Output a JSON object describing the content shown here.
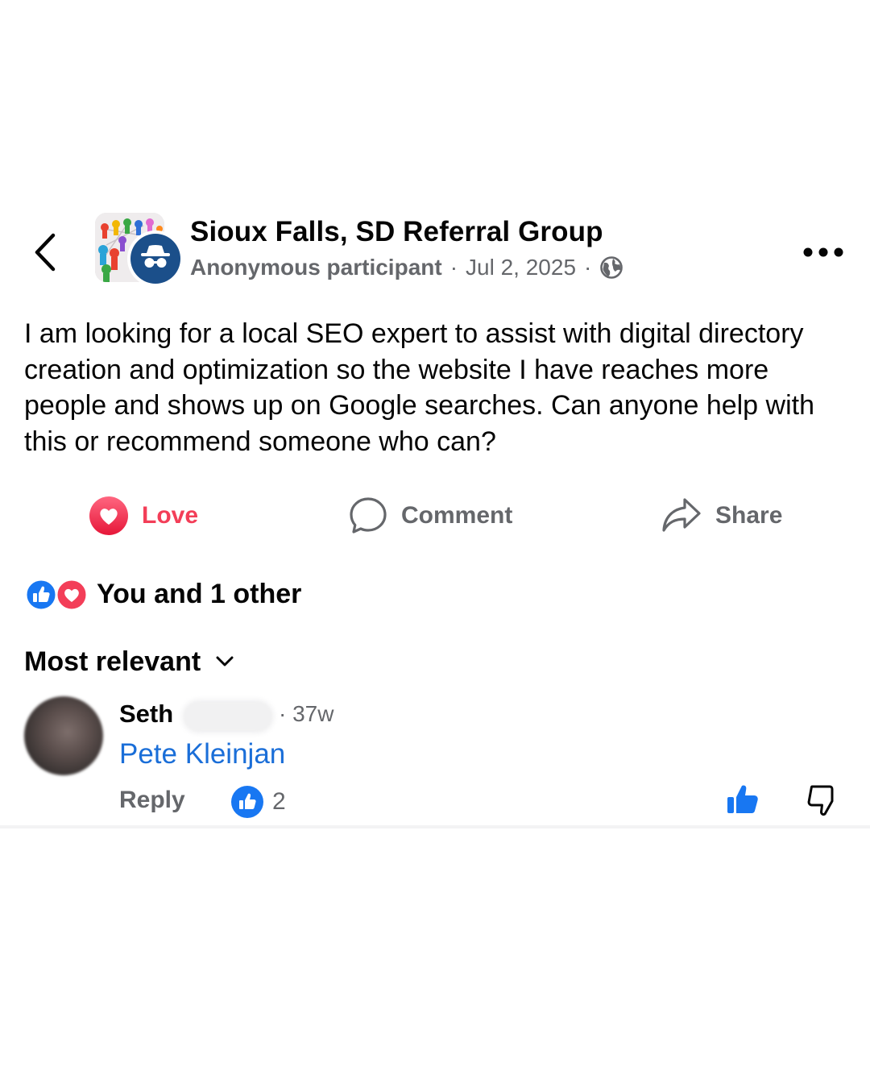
{
  "header": {
    "back_icon": "chevron-left-icon",
    "group_name": "Sioux Falls, SD Referral Group",
    "author": "Anonymous participant",
    "separator": "·",
    "date": "Jul 2, 2025",
    "audience_icon": "globe-icon",
    "more_icon": "more-horizontal-icon"
  },
  "post": {
    "text": "I am looking for a local SEO expert to assist with digital directory creation and optimization so the website I have reaches more people and shows up on Google searches. Can anyone help with this or recommend someone who can?"
  },
  "actions": {
    "love_label": "Love",
    "comment_label": "Comment",
    "share_label": "Share"
  },
  "reactions": {
    "summary": "You and 1 other",
    "icons": [
      "like-reaction-icon",
      "love-reaction-icon"
    ]
  },
  "comments": {
    "sort_label": "Most relevant",
    "items": [
      {
        "name": "Seth",
        "time": "· 37w",
        "text": "Pete Kleinjan",
        "reply_label": "Reply",
        "like_count": "2"
      }
    ]
  },
  "colors": {
    "love": "#f33e58",
    "link": "#1a6ed8",
    "like_blue": "#1877f2",
    "secondary_text": "#65676b",
    "primary_text": "#050505"
  }
}
